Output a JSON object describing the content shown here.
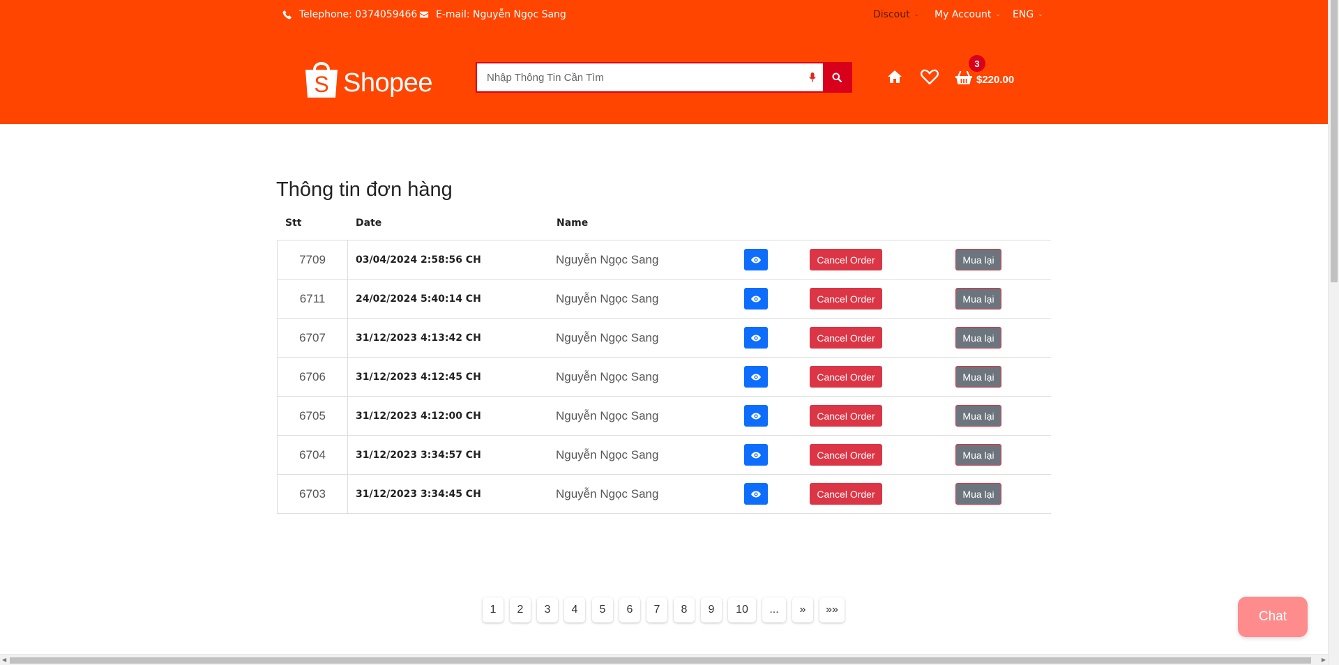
{
  "topbar": {
    "telephone": "Telephone: 0374059466",
    "email": "E-mail: Nguyễn Ngọc Sang",
    "discount": "Discout",
    "account": "My Account",
    "language": "ENG"
  },
  "logo": {
    "text": "Shopee",
    "bag_letter": "S"
  },
  "search": {
    "placeholder": "Nhập Thông Tin Cần Tìm"
  },
  "cart": {
    "count": "3",
    "total": "$220.00"
  },
  "page": {
    "title": "Thông tin đơn hàng",
    "columns": {
      "stt": "Stt",
      "date": "Date",
      "name": "Name"
    }
  },
  "orders": [
    {
      "stt": "7709",
      "date": "03/04/2024 2:58:56 CH",
      "name": "Nguyễn Ngọc Sang"
    },
    {
      "stt": "6711",
      "date": "24/02/2024 5:40:14 CH",
      "name": "Nguyễn Ngọc Sang"
    },
    {
      "stt": "6707",
      "date": "31/12/2023 4:13:42 CH",
      "name": "Nguyễn Ngọc Sang"
    },
    {
      "stt": "6706",
      "date": "31/12/2023 4:12:45 CH",
      "name": "Nguyễn Ngọc Sang"
    },
    {
      "stt": "6705",
      "date": "31/12/2023 4:12:00 CH",
      "name": "Nguyễn Ngọc Sang"
    },
    {
      "stt": "6704",
      "date": "31/12/2023 3:34:57 CH",
      "name": "Nguyễn Ngọc Sang"
    },
    {
      "stt": "6703",
      "date": "31/12/2023 3:34:45 CH",
      "name": "Nguyễn Ngọc Sang"
    }
  ],
  "actions": {
    "cancel_label": "Cancel Order",
    "rebuy_label": "Mua lại"
  },
  "pagination": [
    "1",
    "2",
    "3",
    "4",
    "5",
    "6",
    "7",
    "8",
    "9",
    "10",
    "...",
    "»",
    "»»"
  ],
  "chat": {
    "label": "Chat"
  },
  "colors": {
    "brand": "#ff4500",
    "accent_red": "#d9001b",
    "primary": "#0d6efd",
    "danger": "#dc3545",
    "secondary": "#6c757d"
  }
}
